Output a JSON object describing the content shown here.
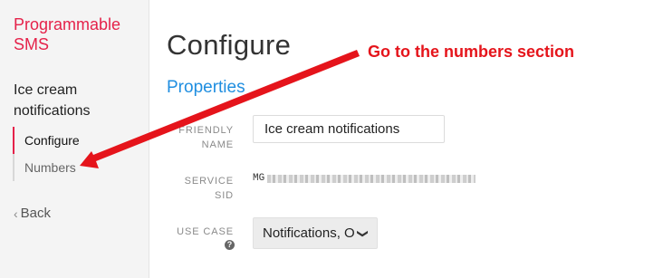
{
  "sidebar": {
    "brand": "Programmable SMS",
    "section_title": "Ice cream notifications",
    "items": [
      {
        "label": "Configure"
      },
      {
        "label": "Numbers"
      }
    ],
    "back_label": "Back",
    "back_icon": "chevron-left-icon"
  },
  "main": {
    "title": "Configure",
    "tab": "Properties",
    "fields": {
      "friendly_name": {
        "label": "FRIENDLY NAME",
        "value": "Ice cream notifications"
      },
      "service_sid": {
        "label": "SERVICE SID",
        "prefix": "MG"
      },
      "use_case": {
        "label": "USE CASE",
        "value": "Notifications, O"
      }
    }
  },
  "annotation": {
    "text": "Go to the numbers section",
    "color": "#e5141b",
    "target": "sidebar-item-numbers"
  },
  "colors": {
    "brand": "#e5224a",
    "link": "#1f8ee0",
    "sidebar_bg": "#f4f4f4"
  }
}
